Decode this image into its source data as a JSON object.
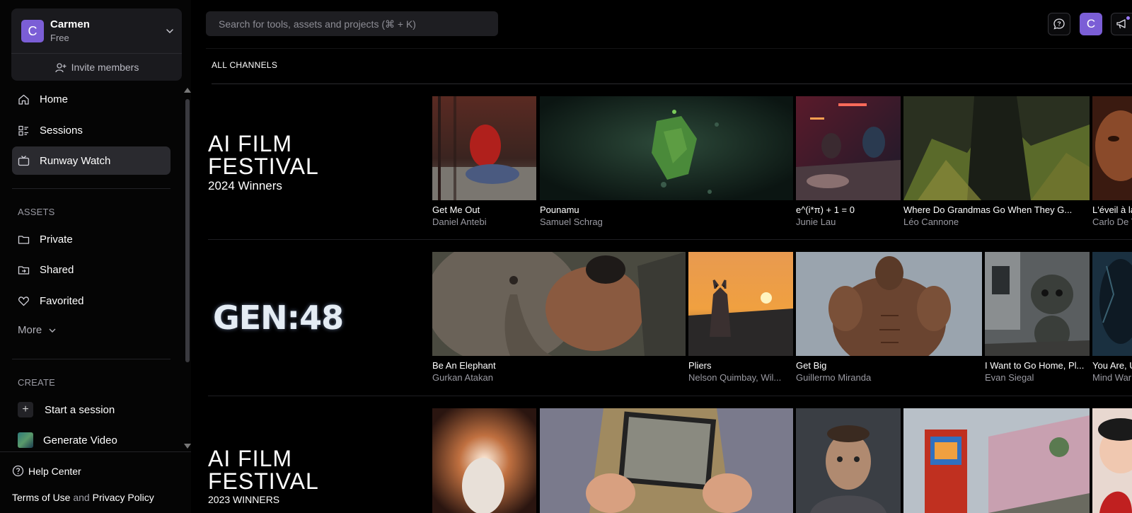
{
  "workspace": {
    "avatar_letter": "C",
    "name": "Carmen",
    "plan": "Free",
    "invite_label": "Invite members"
  },
  "nav": [
    {
      "label": "Home",
      "icon": "home-icon"
    },
    {
      "label": "Sessions",
      "icon": "sessions-icon"
    },
    {
      "label": "Runway Watch",
      "icon": "tv-icon",
      "active": true
    }
  ],
  "assets": {
    "label": "ASSETS",
    "items": [
      {
        "label": "Private",
        "icon": "folder-icon"
      },
      {
        "label": "Shared",
        "icon": "shared-folder-icon"
      },
      {
        "label": "Favorited",
        "icon": "heart-icon"
      }
    ],
    "more_label": "More"
  },
  "create": {
    "label": "CREATE",
    "items": [
      {
        "label": "Start a session",
        "icon": "plus-icon"
      },
      {
        "label": "Generate Video",
        "icon": "video-thumbnail-icon"
      }
    ]
  },
  "footer": {
    "help": "Help Center",
    "terms": "Terms of Use",
    "and": "and",
    "privacy": "Privacy Policy"
  },
  "topbar": {
    "search_placeholder": "Search for tools, assets and projects (⌘ + K)",
    "user_letter": "C"
  },
  "channels_label": "ALL CHANNELS",
  "rows": [
    {
      "logo": {
        "line1": "AI FILM",
        "line2": "FESTIVAL",
        "line3": "2024 Winners"
      },
      "cards": [
        {
          "title": "Get Me Out",
          "author": "Daniel Antebi"
        },
        {
          "title": "Pounamu",
          "author": "Samuel Schrag"
        },
        {
          "title": "e^(i*π) + 1 = 0",
          "author": "Junie Lau"
        },
        {
          "title": "Where Do Grandmas Go When They G...",
          "author": "Léo Cannone"
        },
        {
          "title": "L'éveil à la",
          "author": "Carlo De T"
        }
      ]
    },
    {
      "logo": {
        "text": "GEN:48"
      },
      "cards": [
        {
          "title": "Be An Elephant",
          "author": "Gurkan Atakan"
        },
        {
          "title": "Pliers",
          "author": "Nelson Quimbay, Wil..."
        },
        {
          "title": "Get Big",
          "author": "Guillermo Miranda"
        },
        {
          "title": "I Want to Go Home, Pl...",
          "author": "Evan Siegal"
        },
        {
          "title": "You Are, U",
          "author": "Mind War"
        }
      ]
    },
    {
      "logo": {
        "line1": "AI FILM",
        "line2": "FESTIVAL",
        "line3": "2023 WINNERS"
      },
      "cards": [
        {},
        {},
        {},
        {},
        {}
      ]
    }
  ],
  "colors": {
    "accent": "#7b5ed6",
    "background": "#000000",
    "active_nav": "#2a2a2f",
    "notification_dot": "#9b7bff"
  }
}
